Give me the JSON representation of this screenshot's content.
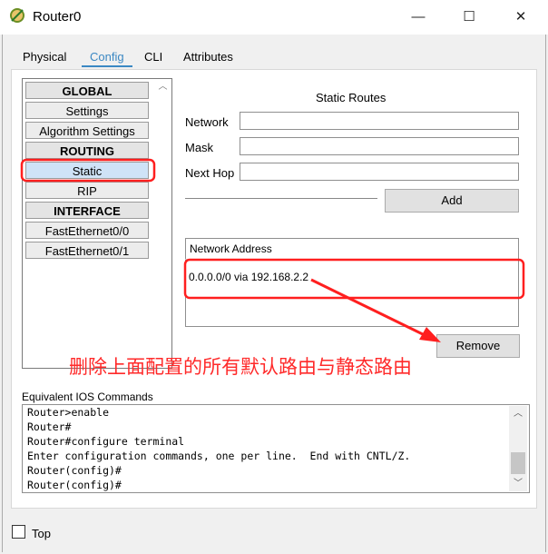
{
  "window": {
    "title": "Router0",
    "minimize": "—",
    "maximize": "☐",
    "close": "✕"
  },
  "tabs": [
    {
      "label": "Physical"
    },
    {
      "label": "Config"
    },
    {
      "label": "CLI"
    },
    {
      "label": "Attributes"
    }
  ],
  "left_list": {
    "items": [
      {
        "label": "GLOBAL"
      },
      {
        "label": "Settings"
      },
      {
        "label": "Algorithm Settings"
      },
      {
        "label": "ROUTING"
      },
      {
        "label": "Static"
      },
      {
        "label": "RIP"
      },
      {
        "label": "INTERFACE"
      },
      {
        "label": "FastEthernet0/0"
      },
      {
        "label": "FastEthernet0/1"
      }
    ]
  },
  "static_routes": {
    "title": "Static Routes",
    "network_label": "Network",
    "network_value": "",
    "mask_label": "Mask",
    "mask_value": "",
    "nexthop_label": "Next Hop",
    "nexthop_value": "",
    "add_label": "Add",
    "list_header": "Network Address",
    "routes": [
      "0.0.0.0/0 via 192.168.2.2"
    ],
    "remove_label": "Remove"
  },
  "commands": {
    "label": "Equivalent IOS Commands",
    "lines": [
      "Router>enable",
      "Router#",
      "Router#configure terminal",
      "Enter configuration commands, one per line.  End with CNTL/Z.",
      "Router(config)#",
      "Router(config)#"
    ]
  },
  "top_checkbox": {
    "label": "Top"
  },
  "annotation": {
    "text": "删除上面配置的所有默认路由与静态路由",
    "color": "#ff2a2a"
  }
}
